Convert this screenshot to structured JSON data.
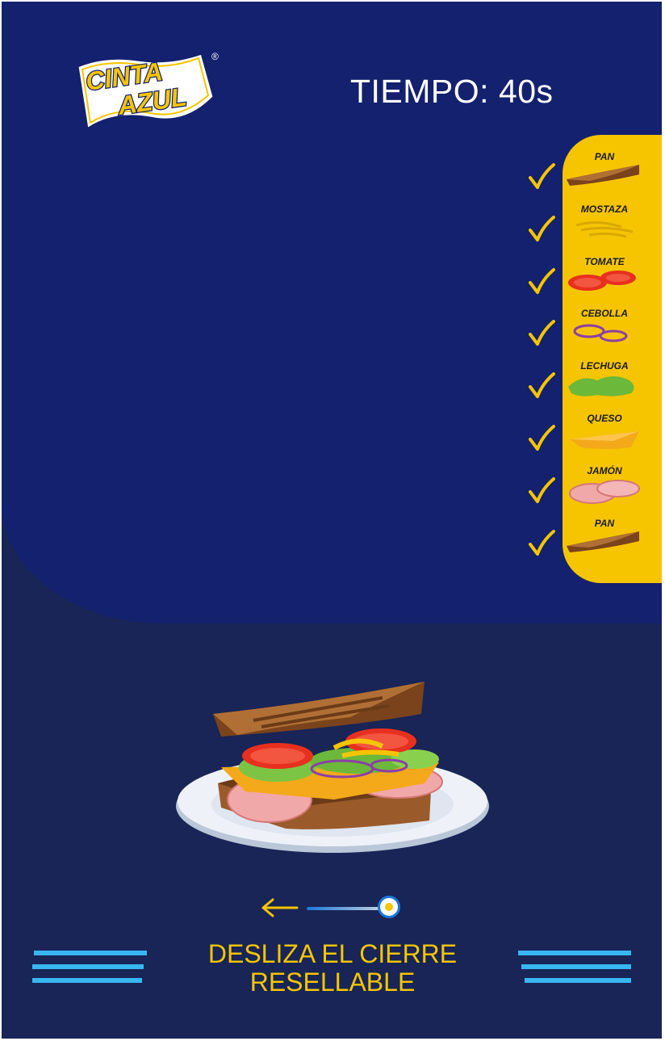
{
  "brand": {
    "logo_line1": "CINTA",
    "logo_line2": "AZUL",
    "registered": "®"
  },
  "timer": {
    "label": "TIEMPO: 40s"
  },
  "ingredients": [
    {
      "label": "PAN",
      "icon": "bread-icon",
      "checked": true
    },
    {
      "label": "MOSTAZA",
      "icon": "mustard-icon",
      "checked": true
    },
    {
      "label": "TOMATE",
      "icon": "tomato-icon",
      "checked": true
    },
    {
      "label": "CEBOLLA",
      "icon": "onion-icon",
      "checked": true
    },
    {
      "label": "LECHUGA",
      "icon": "lettuce-icon",
      "checked": true
    },
    {
      "label": "QUESO",
      "icon": "cheese-icon",
      "checked": true
    },
    {
      "label": "JAMÓN",
      "icon": "ham-icon",
      "checked": true
    },
    {
      "label": "PAN",
      "icon": "bread-icon",
      "checked": true
    }
  ],
  "slider": {
    "arrow_icon": "arrow-left-icon",
    "position": 1.0
  },
  "instruction": {
    "line1": "DESLIZA EL CIERRE",
    "line2": "RESELLABLE"
  },
  "colors": {
    "top_bg": "#14216e",
    "bottom_bg": "#182556",
    "accent_yellow": "#f6c500",
    "stripe_blue": "#38b6f0",
    "check_yellow": "#f6c500"
  }
}
